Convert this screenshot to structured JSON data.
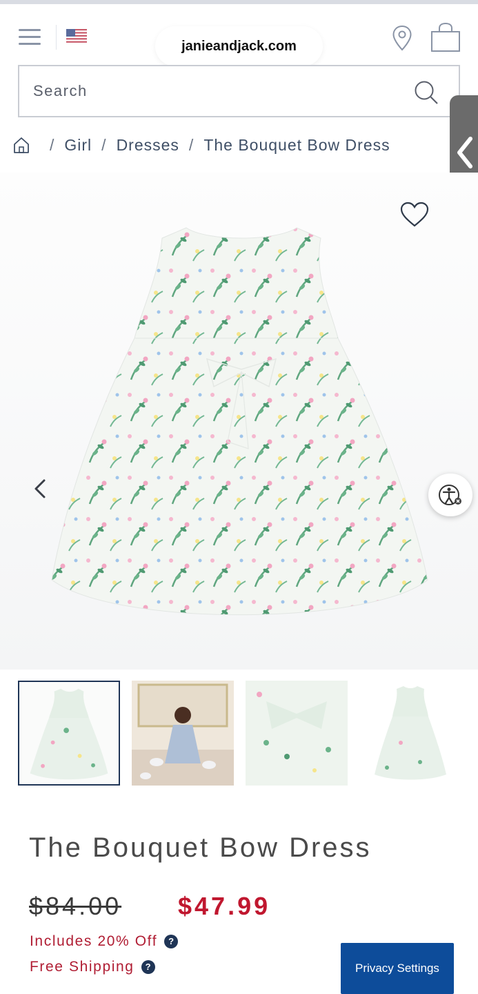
{
  "browser": {
    "url": "janieandjack.com"
  },
  "header": {
    "country": "US"
  },
  "search": {
    "placeholder": "Search"
  },
  "breadcrumb": {
    "items": [
      "Girl",
      "Dresses"
    ],
    "current": "The Bouquet Bow Dress"
  },
  "product": {
    "title": "The Bouquet Bow Dress",
    "original_price": "$84.00",
    "sale_price": "$47.99",
    "promo_discount": "Includes 20% Off",
    "promo_shipping": "Free Shipping",
    "help_glyph": "?"
  },
  "gallery": {
    "thumbnails": [
      "dress-front",
      "model-tea-party",
      "bow-detail",
      "dress-back"
    ],
    "active_index": 0
  },
  "icons": [
    "menu-icon",
    "us-flag-icon",
    "location-pin-icon",
    "shopping-bag-icon",
    "search-icon",
    "home-icon",
    "heart-icon",
    "chevron-left-icon",
    "accessibility-icon"
  ],
  "privacy": {
    "label": "Privacy Settings"
  },
  "colors": {
    "sale": "#c0172f",
    "navy": "#1f3556",
    "privacy_button": "#0d4c9a"
  }
}
